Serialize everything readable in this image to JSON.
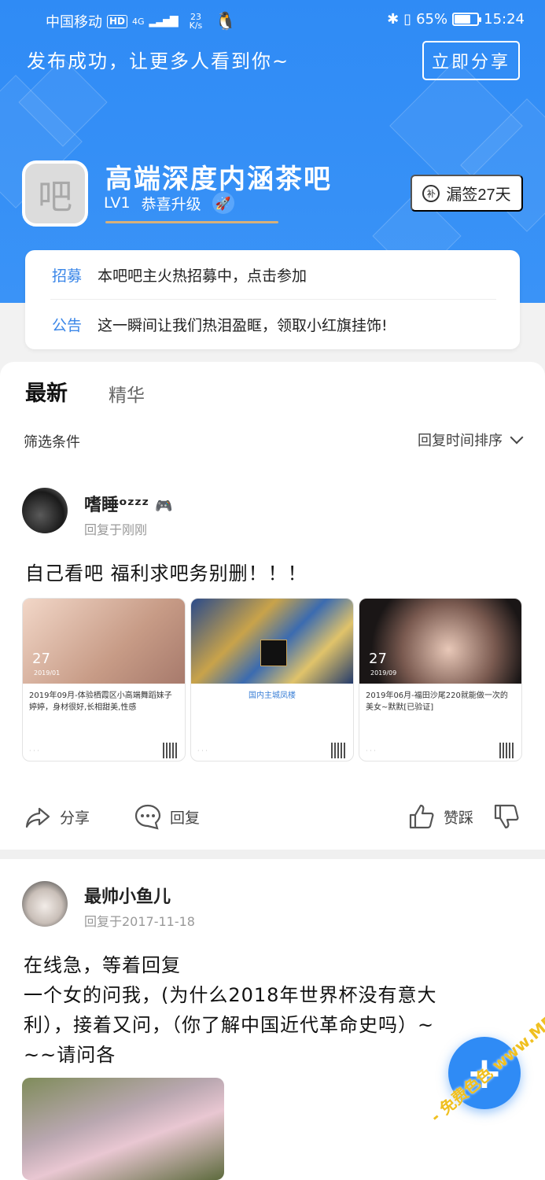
{
  "status_bar": {
    "carrier": "中国移动",
    "hd": "HD",
    "net": "4G",
    "speed_value": "23",
    "speed_unit": "K/s",
    "battery": "65%",
    "time": "15:24"
  },
  "banner": {
    "message": "发布成功，让更多人看到你~",
    "share_label": "立即分享"
  },
  "forum": {
    "avatar_char": "吧",
    "name": "高端深度内涵茶吧",
    "level": "LV1",
    "level_text": "恭喜升级",
    "sign_label": "漏签27天",
    "sign_icon_text": "补"
  },
  "notices": [
    {
      "tag": "招募",
      "text": "本吧吧主火热招募中，点击参加"
    },
    {
      "tag": "公告",
      "text": "这一瞬间让我们热泪盈眶，领取小红旗挂饰!"
    }
  ],
  "tabs": {
    "active": "最新",
    "other": "精华"
  },
  "filter": {
    "label": "筛选条件",
    "sort_label": "回复时间排序"
  },
  "posts": [
    {
      "username": "嗜睡ᵒᶻᶻᶻ",
      "meta": "回复于刚刚",
      "text": "自己看吧 福利求吧务别删！！！",
      "thumbs": [
        {
          "date": "27",
          "sub": "2019/01",
          "caption": "2019年09月-体验栖霞区小高端舞蹈妹子婷婷，身材很好,长相甜美,性感"
        },
        {
          "date": "",
          "sub": "",
          "caption": "国内主城凤楼"
        },
        {
          "date": "27",
          "sub": "2019/09",
          "caption": "2019年06月-福田沙尾220就能做一次的美女~默默[已验证]"
        }
      ],
      "actions": {
        "share": "分享",
        "reply": "回复",
        "like": "赞踩"
      }
    },
    {
      "username": "最帅小鱼儿",
      "meta": "回复于2017-11-18",
      "text_lines": [
        "在线急，等着回复",
        "一个女的问我，(为什么2018年世界杯没有意大",
        "利），接着又问，（你了解中国近代革命史吗）~",
        "~~请问各"
      ]
    }
  ],
  "fab": {
    "label": "+"
  },
  "watermark": "- 免费色色 www.MFsese.com"
}
